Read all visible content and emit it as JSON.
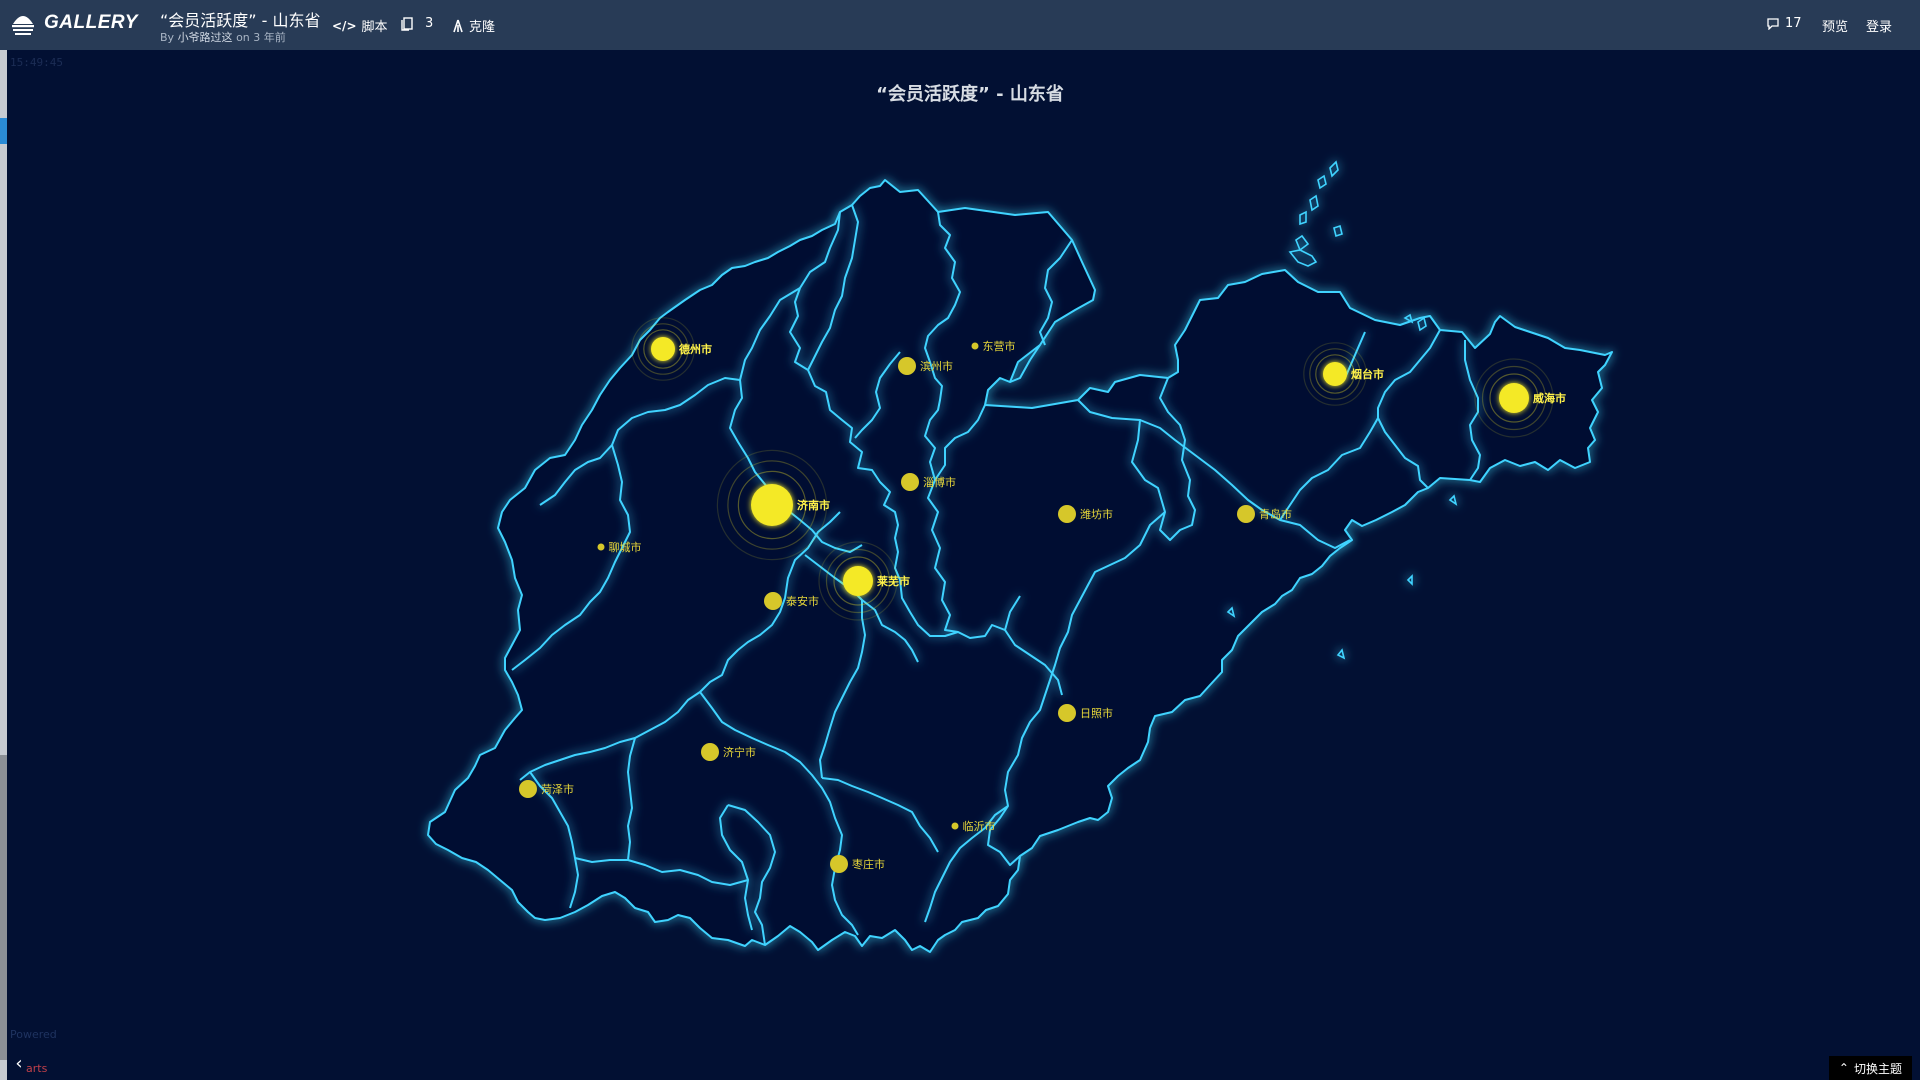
{
  "header": {
    "logo_text": "GALLERY",
    "chart_title": "“会员活跃度” - 山东省",
    "author_prefix": "By",
    "author_name": "小爷路过这",
    "author_suffix": "on 3 年前",
    "tools": [
      {
        "icon": "code-icon",
        "label": "脚本"
      },
      {
        "icon": "copy-icon",
        "label": "3"
      },
      {
        "icon": "fork-icon",
        "label": "克隆"
      }
    ],
    "right_tools": [
      {
        "icon": "comment-icon",
        "label": "17"
      },
      {
        "icon": "",
        "label": "预览"
      },
      {
        "icon": "",
        "label": "登录"
      }
    ]
  },
  "canvas": {
    "timestamp": "15:49:45",
    "powered_text": "Powered",
    "powered_sub": "arts",
    "theme_button": "切换主题"
  },
  "map": {
    "title": "“会员活跃度” - 山东省",
    "border_color": "#3fd3ff",
    "point_color": "#f4e925",
    "label_color": "#e8d83a",
    "cities": [
      {
        "name": "德州市",
        "level": 3,
        "effect": true
      },
      {
        "name": "滨州市",
        "level": 2,
        "effect": false
      },
      {
        "name": "东营市",
        "level": 1,
        "effect": false
      },
      {
        "name": "烟台市",
        "level": 3,
        "effect": true
      },
      {
        "name": "威海市",
        "level": 4,
        "effect": true
      },
      {
        "name": "济南市",
        "level": 5,
        "effect": true
      },
      {
        "name": "淄博市",
        "level": 2,
        "effect": false
      },
      {
        "name": "潍坊市",
        "level": 2,
        "effect": false
      },
      {
        "name": "青岛市",
        "level": 2,
        "effect": false
      },
      {
        "name": "聊城市",
        "level": 1,
        "effect": false
      },
      {
        "name": "莱芜市",
        "level": 4,
        "effect": true
      },
      {
        "name": "泰安市",
        "level": 2,
        "effect": false
      },
      {
        "name": "日照市",
        "level": 2,
        "effect": false
      },
      {
        "name": "济宁市",
        "level": 2,
        "effect": false
      },
      {
        "name": "菏泽市",
        "level": 2,
        "effect": false
      },
      {
        "name": "临沂市",
        "level": 1,
        "effect": false
      },
      {
        "name": "枣庄市",
        "level": 2,
        "effect": false
      }
    ]
  }
}
